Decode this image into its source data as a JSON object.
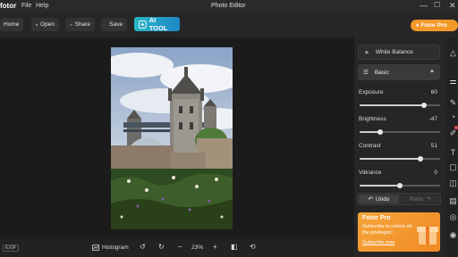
{
  "app": {
    "logo": "fotor",
    "window_title": "Photo Editor"
  },
  "menu": [
    "File",
    "Help"
  ],
  "window_controls": {
    "minimize": "—",
    "maximize": "☐",
    "close": "✕"
  },
  "toolbar": {
    "home": "Home",
    "open": "Open",
    "share": "Share",
    "save": "Save",
    "ai_tool": "AI TOOL",
    "fotor_pro": "Fotor Pro"
  },
  "panel": {
    "white_balance": "White Balance",
    "section": "Basic",
    "adjustments": [
      {
        "label": "Exposure",
        "value": "60",
        "level": 0.8
      },
      {
        "label": "Brightness",
        "value": "-47",
        "level": 0.26
      },
      {
        "label": "Contrast",
        "value": "51",
        "level": 0.75
      },
      {
        "label": "Vibrance",
        "value": "0",
        "level": 0.5
      }
    ],
    "undo": "Undo",
    "redo": "Redo"
  },
  "promo": {
    "title": "Fotor Pro",
    "text": "Subscribe to unlock all the privileges!",
    "button": "Subscribe now"
  },
  "bottom": {
    "exif": "EXIF",
    "histogram": "Histogram",
    "zoom": "23%"
  },
  "colors": {
    "accent": "#f39a2b",
    "ai_tool": "#2ab7c6",
    "background": "#1e1e1e"
  }
}
